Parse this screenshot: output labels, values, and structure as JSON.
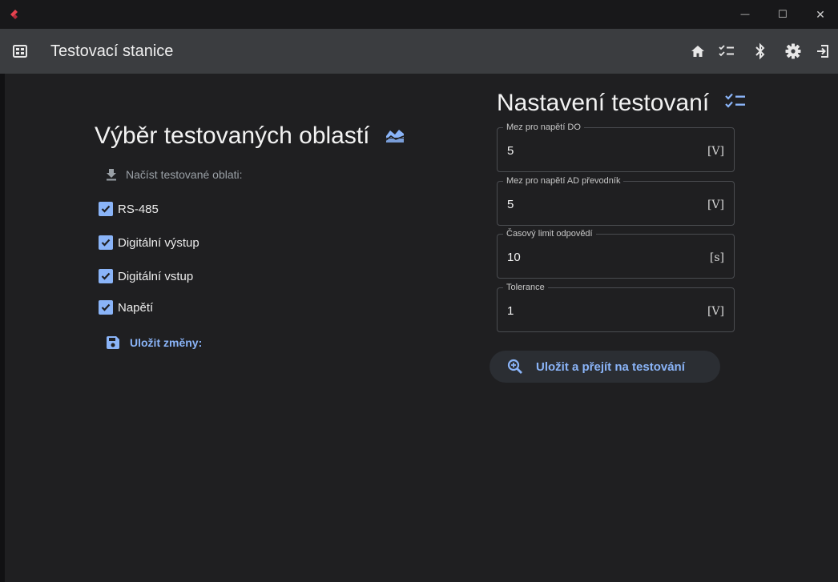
{
  "window": {
    "title": "Testovací stanice",
    "minimize_glyph": "—",
    "maximize_glyph": "☐",
    "close_glyph": "✕"
  },
  "appbar": {
    "title": "Testovací stanice",
    "icons": [
      "dashboard-icon",
      "home-icon",
      "checklist-icon",
      "bluetooth-icon",
      "settings-icon",
      "logout-icon"
    ]
  },
  "left": {
    "heading": "Výběr testovaných oblastí",
    "load_label": "Načíst testované oblati:",
    "checkboxes": [
      {
        "label": "RS-485",
        "checked": true
      },
      {
        "label": "Digitální výstup",
        "checked": true
      },
      {
        "label": "Digitální vstup",
        "checked": true
      },
      {
        "label": "Napětí",
        "checked": true
      }
    ],
    "save_label": "Uložit změny:"
  },
  "right": {
    "heading": "Nastavení testovaní",
    "fields": [
      {
        "label": "Mez pro napětí DO",
        "value": "5",
        "unit": "[V]"
      },
      {
        "label": "Mez pro napětí AD převodník",
        "value": "5",
        "unit": "[V]"
      },
      {
        "label": "Časový limit odpovědí",
        "value": "10",
        "unit": "[s]"
      },
      {
        "label": "Tolerance",
        "value": "1",
        "unit": "[V]"
      }
    ],
    "submit_label": "Uložit a přejít na testování"
  },
  "colors": {
    "accent": "#8ab4f8",
    "background": "#1f1f21",
    "appbar": "#3b3d40"
  }
}
